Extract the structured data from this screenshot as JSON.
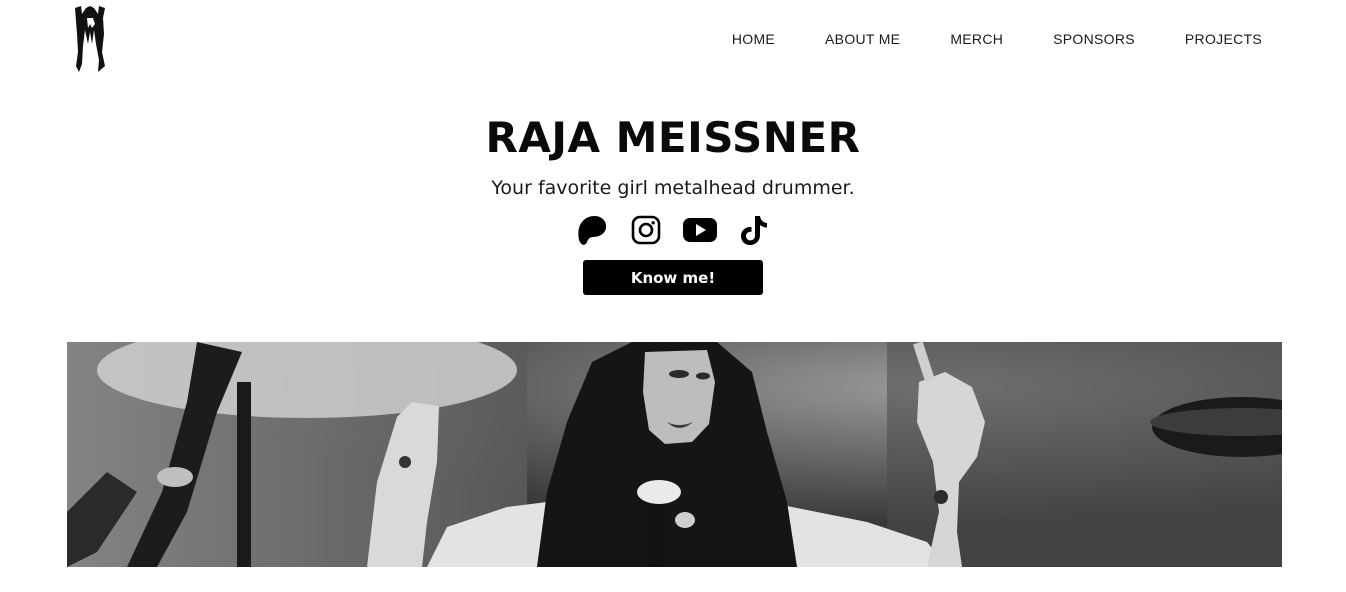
{
  "header": {
    "logo_icon": "mr-monogram-logo",
    "nav": [
      {
        "label": "HOME"
      },
      {
        "label": "ABOUT ME"
      },
      {
        "label": "MERCH"
      },
      {
        "label": "SPONSORS"
      },
      {
        "label": "PROJECTS"
      }
    ]
  },
  "hero": {
    "title": "RAJA MEISSNER",
    "subtitle": "Your favorite girl metalhead drummer.",
    "socials": [
      {
        "icon": "patreon-icon"
      },
      {
        "icon": "instagram-icon"
      },
      {
        "icon": "youtube-icon"
      },
      {
        "icon": "tiktok-icon"
      }
    ],
    "cta_label": "Know me!"
  },
  "banner": {
    "image": "black-and-white photo of drummer performing on stage"
  },
  "colors": {
    "text": "#111111",
    "button_bg": "#000000",
    "button_text": "#ffffff",
    "background": "#ffffff"
  }
}
